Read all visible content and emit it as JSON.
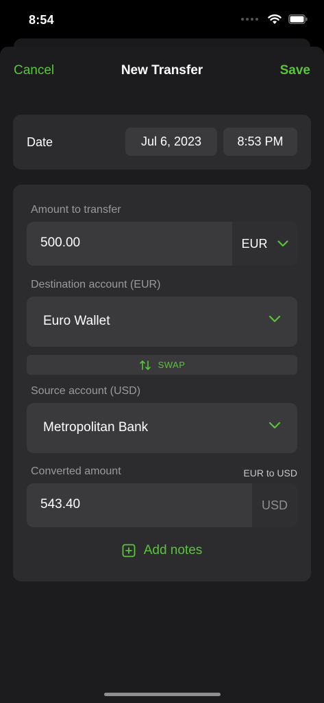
{
  "status_bar": {
    "time": "8:54"
  },
  "nav": {
    "cancel_label": "Cancel",
    "title": "New Transfer",
    "save_label": "Save"
  },
  "date_row": {
    "label": "Date",
    "date": "Jul 6, 2023",
    "time": "8:53 PM"
  },
  "amount": {
    "label": "Amount to transfer",
    "value": "500.00",
    "currency": "EUR"
  },
  "destination": {
    "label": "Destination account (EUR)",
    "account": "Euro Wallet"
  },
  "swap": {
    "label": "SWAP"
  },
  "source": {
    "label": "Source account (USD)",
    "account": "Metropolitan Bank"
  },
  "converted": {
    "label": "Converted amount",
    "rate_label": "EUR to USD",
    "value": "543.40",
    "currency": "USD"
  },
  "notes": {
    "add_label": "Add notes"
  },
  "colors": {
    "accent": "#5ac43a",
    "background": "#1c1c1e",
    "card": "#2c2c2e",
    "field": "#3a3a3c"
  },
  "icons": [
    "wifi-icon",
    "battery-icon",
    "chevron-down-icon",
    "swap-arrows-icon",
    "plus-square-icon"
  ]
}
